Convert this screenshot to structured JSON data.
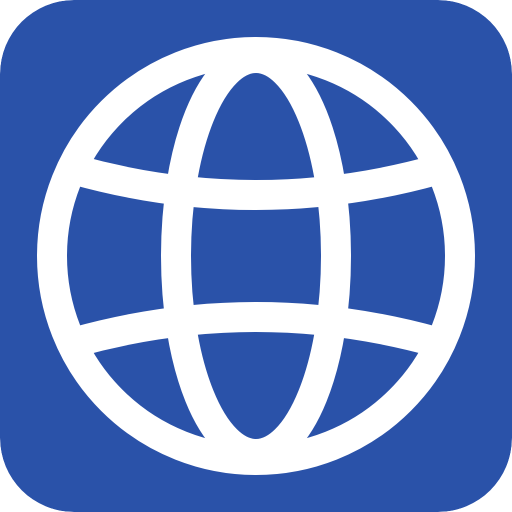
{
  "icon": {
    "name": "globe-icon",
    "background_color": "#2A52A9",
    "foreground_color": "#FFFFFF"
  }
}
